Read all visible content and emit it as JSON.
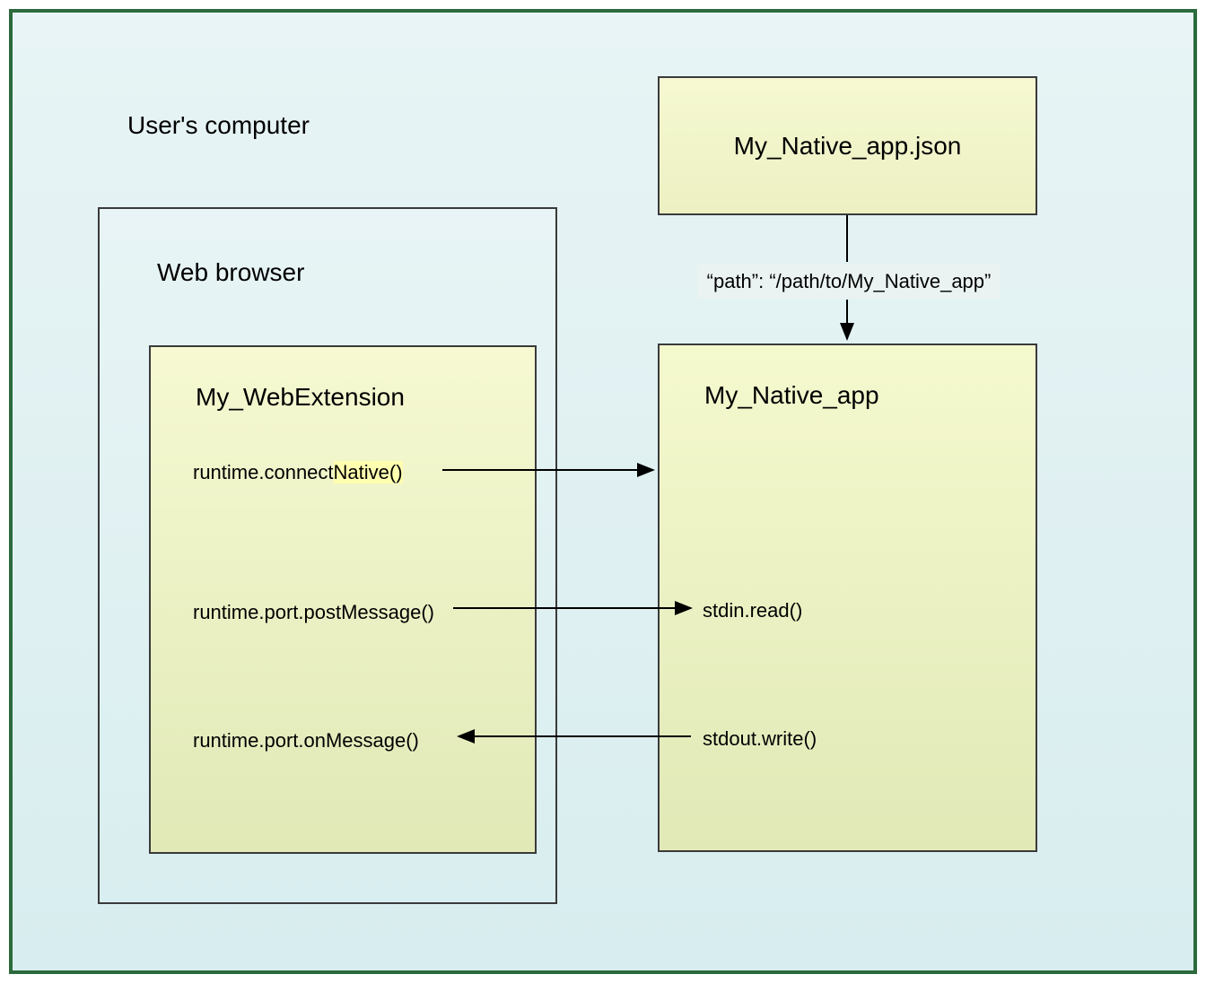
{
  "computer": {
    "label": "User's computer"
  },
  "browser": {
    "label": "Web browser"
  },
  "extension": {
    "title": "My_WebExtension",
    "api1_prefix": "runtime.connect",
    "api1_highlight": "Native()",
    "api2": "runtime.port.postMessage()",
    "api3": "runtime.port.onMessage()"
  },
  "json_manifest": {
    "title": "My_Native_app.json",
    "path_label": "“path”: “/path/to/My_Native_app”"
  },
  "native_app": {
    "title": "My_Native_app",
    "stdin": "stdin.read()",
    "stdout": "stdout.write()"
  }
}
